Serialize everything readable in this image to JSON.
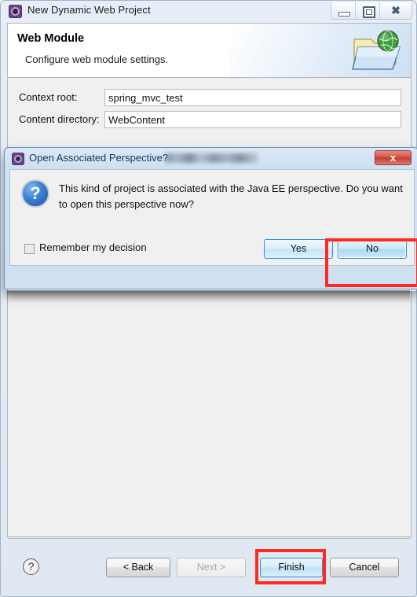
{
  "window": {
    "title": "New Dynamic Web Project",
    "icon": "eclipse-wizard-icon",
    "minimize_label": "–",
    "maximize_label": "❐",
    "close_label": "✖"
  },
  "header": {
    "title": "Web Module",
    "subtitle": "Configure web module settings.",
    "icon": "web-folder-globe-icon"
  },
  "form": {
    "fields": [
      {
        "label": "Context root:",
        "value": "spring_mvc_test",
        "name": "context-root"
      },
      {
        "label": "Content directory:",
        "value": "WebContent",
        "name": "content-directory"
      }
    ]
  },
  "wizard_buttons": {
    "help": "?",
    "back": "< Back",
    "next": "Next >",
    "finish": "Finish",
    "cancel": "Cancel"
  },
  "dialog": {
    "title": "Open Associated Perspective?",
    "title_icon": "eclipse-wizard-icon",
    "close_label": "x",
    "icon": "question-mark-icon",
    "message": "This kind of project is associated with the Java EE perspective.  Do you want to open this perspective now?",
    "checkbox": {
      "label": "Remember my decision",
      "checked": false
    },
    "buttons": {
      "yes": "Yes",
      "no": "No"
    }
  },
  "annotations": {
    "no_button_highlight": "red-rectangle",
    "finish_button_highlight": "red-rectangle",
    "color": "#ff2a20"
  }
}
